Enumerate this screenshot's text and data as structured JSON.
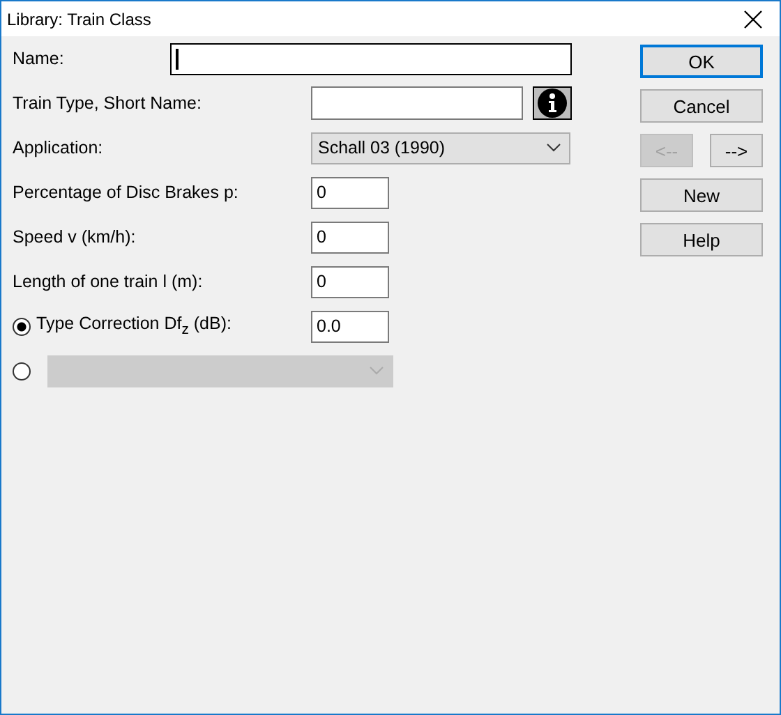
{
  "window": {
    "title": "Library: Train Class"
  },
  "form": [
    {
      "kind": "wide_text",
      "label": "Name:",
      "focused": true
    },
    {
      "kind": "text_info",
      "label": "Train Type, Short Name:"
    },
    {
      "kind": "select",
      "label": "Application:",
      "value": "Schall 03 (1990)"
    },
    {
      "kind": "number",
      "label": "Percentage of Disc Brakes p:",
      "value": "0"
    },
    {
      "kind": "number",
      "label": "Speed v (km/h):",
      "value": "0"
    },
    {
      "kind": "number",
      "label": "Length of one train l (m):",
      "value": "0"
    },
    {
      "kind": "radio_number",
      "label": "Type Correction Df$_{z}$ (dB):",
      "value": "0.0",
      "selected": true
    },
    {
      "kind": "radio_select",
      "selected": false,
      "disabled": true
    }
  ],
  "buttons": [
    {
      "label": "OK",
      "default": true,
      "disabled": false
    },
    {
      "label": "Cancel",
      "default": false,
      "disabled": false
    },
    {
      "label": "<--",
      "default": false,
      "disabled": true
    },
    {
      "label": "-->",
      "default": false,
      "disabled": false
    },
    {
      "label": "New",
      "default": false,
      "disabled": false
    },
    {
      "label": "Help",
      "default": false,
      "disabled": false
    }
  ]
}
